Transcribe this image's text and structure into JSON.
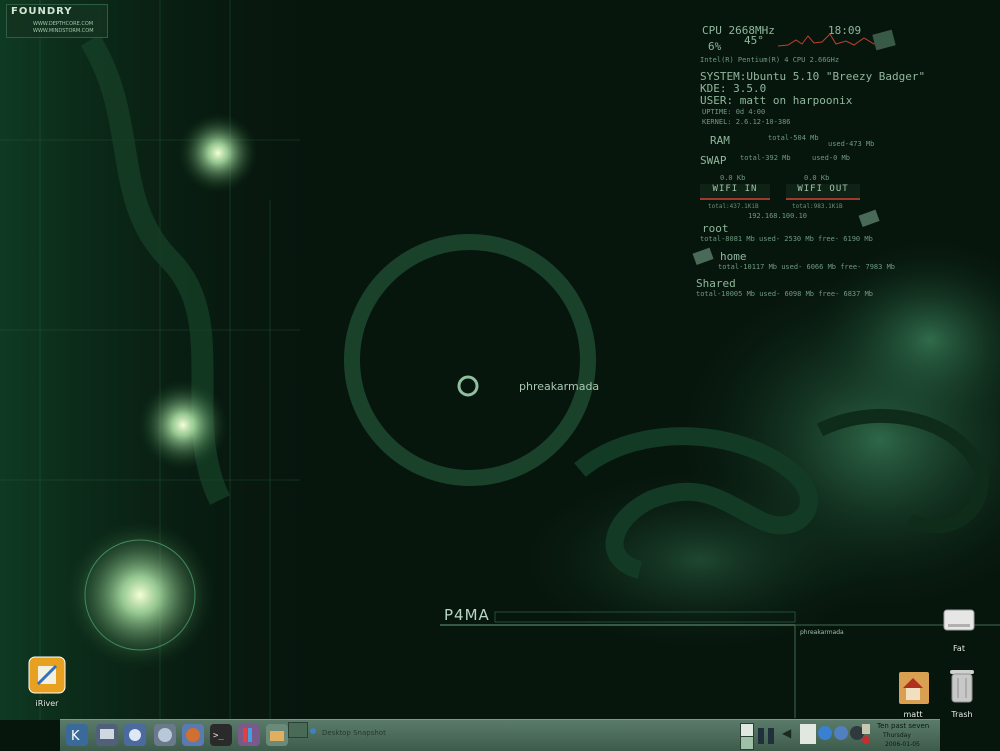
{
  "branding": {
    "name": "FOUNDRY",
    "url1": "WWW.DEPTHCORE.COM",
    "url2": "WWW.MINDSTORM.COM"
  },
  "wallpaper": {
    "phreak": "phreakarmada",
    "p4ma": "P4MA",
    "phreak_small": "phreakarmada"
  },
  "sysmon": {
    "cpu_label": "CPU 2668MHz",
    "time": "18:09",
    "cpu_pct": "6%",
    "temp": "45°",
    "cpu_model": "Intel(R) Pentium(R) 4 CPU 2.66GHz",
    "system": "SYSTEM:Ubuntu 5.10 \"Breezy Badger\"",
    "kde": "KDE:   3.5.0",
    "user": "USER:  matt on harpoonix",
    "uptime": "UPTIME: 0d 4:00",
    "kernel": "KERNEL: 2.6.12-10-386",
    "ram": "RAM",
    "ram_total": "total-504 Mb",
    "ram_used": "used-473 Mb",
    "swap": "SWAP",
    "swap_total": "total-392 Mb",
    "swap_used": "used-0 Mb",
    "wifi_in_val": "0.0 Kb",
    "wifi_out_val": "0.0 Kb",
    "wifi_in": "WIFI IN",
    "wifi_out": "WIFI OUT",
    "wifi_in_total": "total:437.1KiB",
    "wifi_out_total": "total:983.1KiB",
    "ip": "192.168.100.10",
    "root": "root",
    "root_stats": "total-8081 Mb  used- 2530 Mb  free- 6190 Mb",
    "home": "home",
    "home_stats": "total-10117 Mb  used-   6066 Mb  free- 7983 Mb",
    "shared": "Shared",
    "shared_stats": "total-10005 Mb  used- 6098 Mb  free- 6837 Mb"
  },
  "desktop_icons": {
    "iriver": "iRiver",
    "fat": "Fat",
    "matt": "matt",
    "trash": "Trash"
  },
  "taskbar": {
    "window_title": "Desktop Snapshot",
    "clock_top": "Ten past seven",
    "clock_day": "Thursday",
    "clock_date": "2006-01-05"
  }
}
